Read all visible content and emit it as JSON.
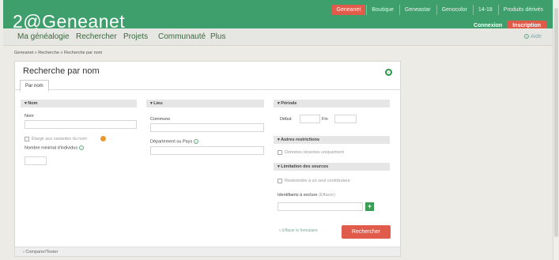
{
  "header": {
    "logo_prefix": "2",
    "logo_text": "Geneanet",
    "top_tabs": [
      "Geneanet",
      "Boutique",
      "Geneastar",
      "Genocolor",
      "14-18",
      "Produits dérivés"
    ],
    "active_tab": "Geneanet",
    "connexion": "Connexion",
    "inscription": "Inscription"
  },
  "nav": {
    "items": [
      "Ma généalogie",
      "Rechercher",
      "Projets",
      "Communauté",
      "Plus"
    ],
    "aide": "Aide"
  },
  "breadcrumb": "Geneanet » Recherche » Recherche par nom",
  "page": {
    "title": "Recherche par nom",
    "tab": "Par nom"
  },
  "form": {
    "nom": {
      "header": "Nom",
      "label": "Nom",
      "checkbox_label": "Élargir aux variantes du nom",
      "nombre_label": "Nombre minimal d'individus"
    },
    "lieu": {
      "header": "Lieu",
      "commune_label": "Commune",
      "departement_label": "Département ou Pays"
    },
    "periode": {
      "header": "Période",
      "debut_label": "Début",
      "fin_label": "Fin"
    },
    "autres": {
      "header": "Autres restrictions",
      "checkbox_label": "Données récentes uniquement"
    },
    "limitation": {
      "header": "Limitation des sources",
      "checkbox_label": "Restreindre à un seul contributeur",
      "identifiants_label": "Identifiants à exclure",
      "identifiants_hint": "(Effacer)"
    },
    "reset_label": "« Effacer le formulaire",
    "search_button": "Rechercher"
  },
  "footer": {
    "comparer": "Comparer/Tester"
  },
  "colors": {
    "brand_green": "#3f9f6c",
    "accent_red": "#e15b4c"
  }
}
